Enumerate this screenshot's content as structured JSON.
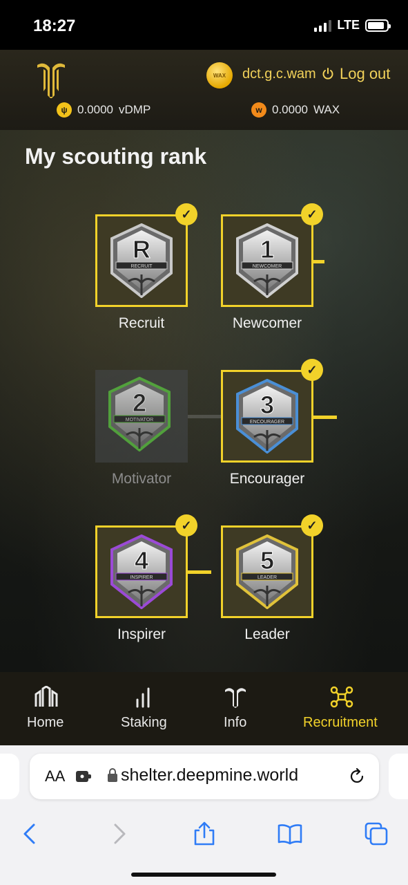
{
  "status_bar": {
    "time": "18:27",
    "network": "LTE",
    "battery_level": 0.9
  },
  "header": {
    "account": "dct.g.c.wam",
    "avatar_text": "WAX",
    "logout_label": "Log out",
    "balances": [
      {
        "amount": "0.0000",
        "currency": "vDMP"
      },
      {
        "amount": "0.0000",
        "currency": "WAX"
      }
    ]
  },
  "page": {
    "title": "My scouting rank"
  },
  "ranks": [
    {
      "label": "Recruit",
      "badge_text": "R",
      "badge_caption": "RECRUIT",
      "achieved": true,
      "color": "#c8c8c8"
    },
    {
      "label": "Newcomer",
      "badge_text": "1",
      "badge_caption": "NEWCOMER",
      "achieved": true,
      "color": "#d0d0d0"
    },
    {
      "label": "Motivator",
      "badge_text": "2",
      "badge_caption": "MOTIVATOR",
      "achieved": false,
      "color": "#59c23d"
    },
    {
      "label": "Encourager",
      "badge_text": "3",
      "badge_caption": "ENCOURAGER",
      "achieved": true,
      "color": "#4a8fd6"
    },
    {
      "label": "Inspirer",
      "badge_text": "4",
      "badge_caption": "INSPIRER",
      "achieved": true,
      "color": "#9b4ad6"
    },
    {
      "label": "Leader",
      "badge_text": "5",
      "badge_caption": "LEADER",
      "achieved": true,
      "color": "#e0c23a"
    }
  ],
  "nav": [
    {
      "label": "Home",
      "icon": "home-icon",
      "active": false
    },
    {
      "label": "Staking",
      "icon": "staking-icon",
      "active": false
    },
    {
      "label": "Info",
      "icon": "info-icon",
      "active": false
    },
    {
      "label": "Recruitment",
      "icon": "recruitment-icon",
      "active": true
    }
  ],
  "browser": {
    "aa_label": "AA",
    "url": "shelter.deepmine.world"
  },
  "colors": {
    "accent": "#f2d22a",
    "header_bg": "#1d1b15",
    "nav_bg": "#1c1a13"
  }
}
